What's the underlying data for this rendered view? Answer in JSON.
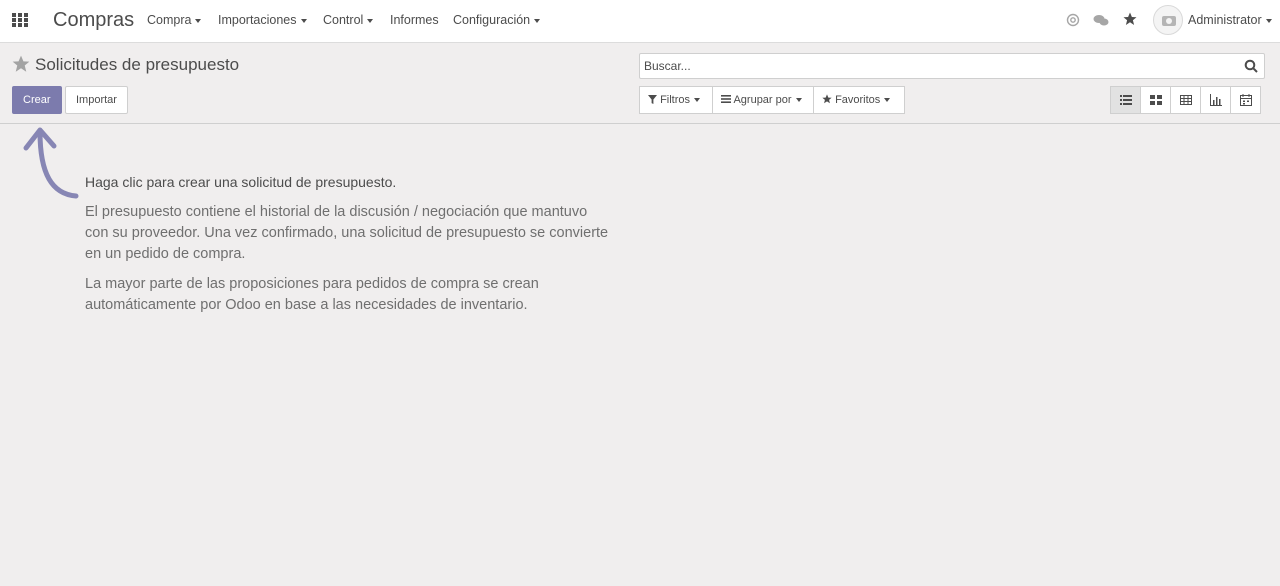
{
  "navbar": {
    "brand": "Compras",
    "menu": [
      {
        "label": "Compra",
        "dropdown": true
      },
      {
        "label": "Importaciones",
        "dropdown": true
      },
      {
        "label": "Control",
        "dropdown": true
      },
      {
        "label": "Informes",
        "dropdown": false
      },
      {
        "label": "Configuración",
        "dropdown": true
      }
    ],
    "icons": [
      "apps-icon",
      "at-icon",
      "chat-icon",
      "star-icon",
      "avatar"
    ],
    "user": "Administrator"
  },
  "control_panel": {
    "title": "Solicitudes de presupuesto",
    "create_label": "Crear",
    "import_label": "Importar",
    "search": {
      "placeholder": "Buscar..."
    },
    "filters_label": "Filtros",
    "groupby_label": "Agrupar por",
    "favorites_label": "Favoritos",
    "views": [
      "list",
      "kanban",
      "pivot",
      "graph",
      "calendar"
    ],
    "active_view": "list"
  },
  "help": {
    "title": "Haga clic para crear una solicitud de presupuesto.",
    "paragraph1_lines": [
      "El presupuesto contiene el historial de la discusión / negociación que mantuvo",
      "con su proveedor. Una vez confirmado, una solicitud de presupuesto se convierte",
      "en un pedido de compra."
    ],
    "paragraph2_lines": [
      "La mayor parte de las proposiciones para pedidos de compra se crean",
      "automáticamente por Odoo en base a las necesidades de inventario."
    ]
  },
  "colors": {
    "primary": "#7c7bad",
    "background": "#f0eeee",
    "text": "#4c4c4c",
    "muted_text": "#6f6f6f"
  }
}
